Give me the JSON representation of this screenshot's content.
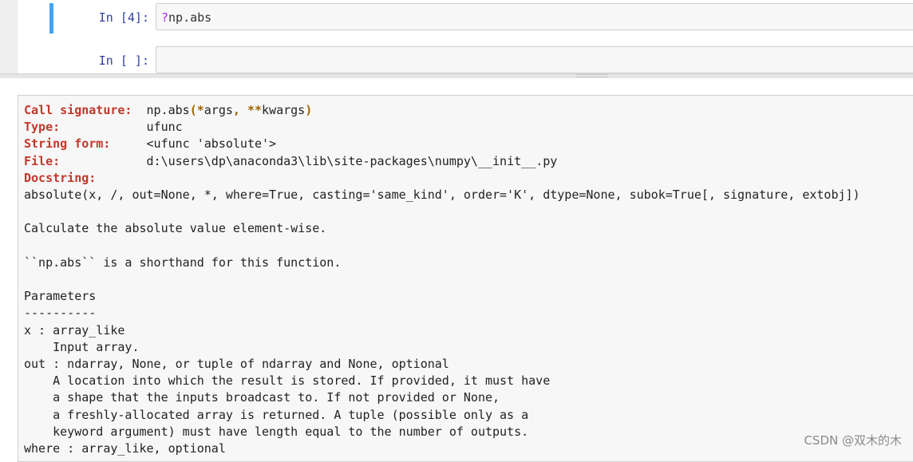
{
  "cells": [
    {
      "prompt": "In  [4]:",
      "code_q": "?",
      "code_rest": "np.abs"
    },
    {
      "prompt": "In  [ ]:",
      "code": ""
    }
  ],
  "pager": {
    "sig_label": "Call signature:",
    "sig_name": "np.abs",
    "sig_open": "(",
    "sig_star1": "*",
    "sig_args": "args",
    "sig_comma": ", ",
    "sig_star2": "**",
    "sig_kwargs": "kwargs",
    "sig_close": ")",
    "type_label": "Type:",
    "type_value": "ufunc",
    "string_form_label": "String form:",
    "string_form_value": "<ufunc 'absolute'>",
    "file_label": "File:",
    "file_value": "d:\\users\\dp\\anaconda3\\lib\\site-packages\\numpy\\__init__.py",
    "docstring_label": "Docstring:",
    "doc_lines": [
      "absolute(x, /, out=None, *, where=True, casting='same_kind', order='K', dtype=None, subok=True[, signature, extobj])",
      "",
      "Calculate the absolute value element-wise.",
      "",
      "``np.abs`` is a shorthand for this function.",
      "",
      "Parameters",
      "----------",
      "x : array_like",
      "    Input array.",
      "out : ndarray, None, or tuple of ndarray and None, optional",
      "    A location into which the result is stored. If provided, it must have",
      "    a shape that the inputs broadcast to. If not provided or None,",
      "    a freshly-allocated array is returned. A tuple (possible only as a",
      "    keyword argument) must have length equal to the number of outputs.",
      "where : array_like, optional"
    ]
  },
  "watermark": "CSDN @双木的木"
}
